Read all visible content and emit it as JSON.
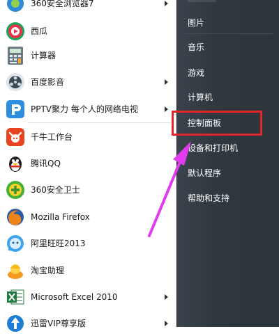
{
  "programs": [
    {
      "label": "360安全浏览器7",
      "icon": "360-browser-icon",
      "arrow": true
    },
    {
      "label": "西瓜",
      "icon": "xigua-icon",
      "arrow": false
    },
    {
      "label": "计算器",
      "icon": "calculator-icon",
      "arrow": false
    },
    {
      "label": "百度影音",
      "icon": "baidu-player-icon",
      "arrow": true
    },
    {
      "label": "PPTV聚力 每个人的网络电视",
      "icon": "pptv-icon",
      "arrow": true
    },
    {
      "label": "千牛工作台",
      "icon": "qianniu-icon",
      "arrow": false
    },
    {
      "label": "腾讯QQ",
      "icon": "qq-penguin-icon",
      "arrow": false
    },
    {
      "label": "360安全卫士",
      "icon": "360-security-icon",
      "arrow": false
    },
    {
      "label": "Mozilla Firefox",
      "icon": "firefox-icon",
      "arrow": false
    },
    {
      "label": "阿里旺旺2013",
      "icon": "aliwangwang-icon",
      "arrow": false
    },
    {
      "label": "淘宝助理",
      "icon": "taobao-assistant-icon",
      "arrow": false
    },
    {
      "label": "Microsoft Excel 2010",
      "icon": "excel-icon",
      "arrow": true
    },
    {
      "label": "迅雷VIP尊享版",
      "icon": "xunlei-icon",
      "arrow": true
    }
  ],
  "right_items": [
    {
      "label": "图片"
    },
    {
      "label": "音乐"
    },
    {
      "label": "游戏"
    },
    {
      "label": "计算机"
    },
    {
      "label": "控制面板"
    },
    {
      "label": "设备和打印机"
    },
    {
      "label": "默认程序"
    },
    {
      "label": "帮助和支持"
    }
  ],
  "colors": {
    "highlight_box": "#e3242b",
    "annotation_arrow": "#e23cf0",
    "right_panel": "#2f383f"
  }
}
